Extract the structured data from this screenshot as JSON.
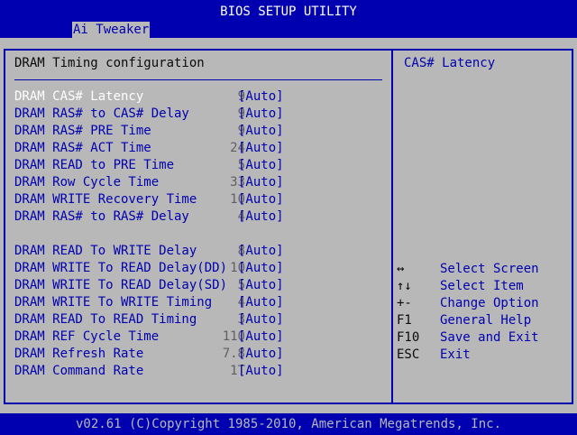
{
  "title": "BIOS SETUP UTILITY",
  "active_tab": "Ai Tweaker",
  "section_heading": "DRAM Timing configuration",
  "help_title": "CAS# Latency",
  "settings": [
    {
      "label": "DRAM CAS# Latency",
      "value": "9",
      "option": "[Auto]",
      "selected": true
    },
    {
      "label": "DRAM RAS# to CAS# Delay",
      "value": "9",
      "option": "[Auto]"
    },
    {
      "label": "DRAM RAS# PRE Time",
      "value": "9",
      "option": "[Auto]"
    },
    {
      "label": "DRAM RAS# ACT Time",
      "value": "24",
      "option": "[Auto]"
    },
    {
      "label": "DRAM READ to PRE Time",
      "value": "5",
      "option": "[Auto]"
    },
    {
      "label": "DRAM Row Cycle Time",
      "value": "33",
      "option": "[Auto]"
    },
    {
      "label": "DRAM WRITE Recovery Time",
      "value": "10",
      "option": "[Auto]"
    },
    {
      "label": "DRAM RAS# to RAS# Delay",
      "value": "4",
      "option": "[Auto]"
    },
    {
      "label": "DRAM READ To WRITE Delay",
      "value": "8",
      "option": "[Auto]"
    },
    {
      "label": "DRAM WRITE To READ Delay(DD)",
      "value": "10",
      "option": "[Auto]"
    },
    {
      "label": "DRAM WRITE To READ Delay(SD)",
      "value": "5",
      "option": "[Auto]"
    },
    {
      "label": "DRAM WRITE To WRITE Timing",
      "value": "4",
      "option": "[Auto]"
    },
    {
      "label": "DRAM READ To READ Timing",
      "value": "3",
      "option": "[Auto]"
    },
    {
      "label": "DRAM REF Cycle Time",
      "value": "110",
      "option": "[Auto]"
    },
    {
      "label": "DRAM Refresh Rate",
      "value": "7.8",
      "option": "[Auto]"
    },
    {
      "label": "DRAM Command Rate",
      "value": "1T",
      "option": "[Auto]"
    }
  ],
  "keys": [
    {
      "key": "↔",
      "desc": "Select Screen"
    },
    {
      "key": "↑↓",
      "desc": "Select Item"
    },
    {
      "key": "+-",
      "desc": "Change Option"
    },
    {
      "key": "F1",
      "desc": "General Help"
    },
    {
      "key": "F10",
      "desc": "Save and Exit"
    },
    {
      "key": "ESC",
      "desc": "Exit"
    }
  ],
  "footer": "v02.61 (C)Copyright 1985-2010, American Megatrends, Inc.",
  "colors": {
    "bios_blue": "#0000b0",
    "panel_gray": "#b8b8b8",
    "highlight": "#ffffff"
  }
}
